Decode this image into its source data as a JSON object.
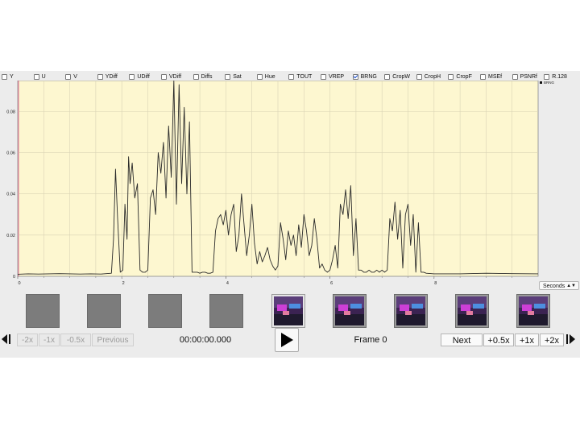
{
  "filters": [
    {
      "label": "Y",
      "checked": false
    },
    {
      "label": "U",
      "checked": false
    },
    {
      "label": "V",
      "checked": false
    },
    {
      "label": "YDiff",
      "checked": false
    },
    {
      "label": "UDiff",
      "checked": false
    },
    {
      "label": "VDiff",
      "checked": false
    },
    {
      "label": "Diffs",
      "checked": false
    },
    {
      "label": "Sat",
      "checked": false
    },
    {
      "label": "Hue",
      "checked": false
    },
    {
      "label": "TOUT",
      "checked": false
    },
    {
      "label": "VREP",
      "checked": false
    },
    {
      "label": "BRNG",
      "checked": true
    },
    {
      "label": "CropW",
      "checked": false
    },
    {
      "label": "CropH",
      "checked": false
    },
    {
      "label": "CropF",
      "checked": false
    },
    {
      "label": "MSEf",
      "checked": false
    },
    {
      "label": "PSNRf",
      "checked": false
    },
    {
      "label": "R.128",
      "checked": false
    }
  ],
  "chart_data": {
    "type": "line",
    "legend": [
      "BRNG"
    ],
    "legend_placement": "top-right",
    "xlim": [
      0,
      10.0
    ],
    "ylim": [
      0,
      0.095
    ],
    "xticks": [
      "0",
      "2",
      "4",
      "6",
      "8"
    ],
    "yticks": [
      "0",
      "0.02",
      "0.04",
      "0.06",
      "0.08"
    ],
    "grid": true,
    "background": "#fdf7d0",
    "line_color": "#2a2a2a",
    "series": [
      {
        "x": [
          0,
          0.2,
          0.4,
          0.6,
          0.8,
          1.0,
          1.2,
          1.4,
          1.6,
          1.8,
          1.84,
          1.88,
          1.92,
          1.97,
          2.02,
          2.06,
          2.1,
          2.13,
          2.16,
          2.2,
          2.25,
          2.3,
          2.35,
          2.4,
          2.45,
          2.5,
          2.55,
          2.6,
          2.65,
          2.7,
          2.75,
          2.8,
          2.85,
          2.9,
          2.95,
          3.0,
          3.05,
          3.1,
          3.15,
          3.2,
          3.25,
          3.3,
          3.35,
          3.4,
          3.45,
          3.5,
          3.55,
          3.6,
          3.65,
          3.7,
          3.75,
          3.8,
          3.85,
          3.9,
          3.95,
          4.0,
          4.05,
          4.1,
          4.15,
          4.2,
          4.25,
          4.3,
          4.35,
          4.4,
          4.45,
          4.5,
          4.55,
          4.6,
          4.65,
          4.7,
          4.75,
          4.8,
          4.85,
          4.9,
          4.95,
          5.0,
          5.05,
          5.1,
          5.15,
          5.2,
          5.25,
          5.3,
          5.35,
          5.4,
          5.45,
          5.5,
          5.55,
          5.6,
          5.65,
          5.7,
          5.75,
          5.8,
          5.85,
          5.9,
          5.95,
          6.0,
          6.05,
          6.1,
          6.15,
          6.2,
          6.25,
          6.3,
          6.35,
          6.4,
          6.45,
          6.5,
          6.55,
          6.6,
          6.65,
          6.7,
          6.75,
          6.8,
          6.85,
          6.9,
          6.95,
          7.0,
          7.05,
          7.1,
          7.15,
          7.2,
          7.25,
          7.3,
          7.35,
          7.4,
          7.45,
          7.5,
          7.55,
          7.6,
          7.65,
          7.7,
          7.75,
          7.8,
          7.85,
          8.0,
          8.5,
          9.0,
          9.5,
          10.0
        ],
        "y": [
          0.001,
          0.0012,
          0.0011,
          0.0012,
          0.0013,
          0.0012,
          0.0011,
          0.0012,
          0.0011,
          0.0015,
          0.018,
          0.052,
          0.028,
          0.002,
          0.003,
          0.035,
          0.018,
          0.058,
          0.045,
          0.055,
          0.038,
          0.045,
          0.003,
          0.002,
          0.002,
          0.003,
          0.038,
          0.042,
          0.03,
          0.06,
          0.05,
          0.065,
          0.038,
          0.073,
          0.048,
          0.095,
          0.035,
          0.093,
          0.045,
          0.082,
          0.04,
          0.075,
          0.002,
          0.002,
          0.002,
          0.0015,
          0.002,
          0.002,
          0.0015,
          0.0015,
          0.002,
          0.022,
          0.028,
          0.03,
          0.025,
          0.032,
          0.02,
          0.03,
          0.035,
          0.012,
          0.02,
          0.04,
          0.025,
          0.01,
          0.02,
          0.035,
          0.016,
          0.006,
          0.012,
          0.007,
          0.01,
          0.014,
          0.008,
          0.005,
          0.003,
          0.005,
          0.026,
          0.018,
          0.008,
          0.022,
          0.015,
          0.02,
          0.01,
          0.025,
          0.014,
          0.03,
          0.022,
          0.01,
          0.015,
          0.028,
          0.018,
          0.004,
          0.006,
          0.003,
          0.002,
          0.003,
          0.008,
          0.015,
          0.004,
          0.035,
          0.03,
          0.042,
          0.028,
          0.044,
          0.01,
          0.028,
          0.003,
          0.003,
          0.002,
          0.002,
          0.003,
          0.002,
          0.002,
          0.003,
          0.002,
          0.003,
          0.002,
          0.003,
          0.028,
          0.022,
          0.036,
          0.018,
          0.032,
          0.004,
          0.03,
          0.035,
          0.015,
          0.03,
          0.002,
          0.026,
          0.002,
          0.002,
          0.0015,
          0.0012,
          0.0012,
          0.0015,
          0.0013,
          0.0012
        ]
      }
    ]
  },
  "thumbnails": [
    {
      "kind": "blank"
    },
    {
      "kind": "blank"
    },
    {
      "kind": "blank"
    },
    {
      "kind": "blank"
    },
    {
      "kind": "image",
      "selected": true
    },
    {
      "kind": "image",
      "selected": false
    },
    {
      "kind": "image",
      "selected": false
    },
    {
      "kind": "image",
      "selected": false
    },
    {
      "kind": "image",
      "selected": false
    }
  ],
  "unit_select": {
    "value": "Seconds"
  },
  "controls": {
    "minus_2x": "-2x",
    "minus_1x": "-1x",
    "minus_half": "-0.5x",
    "previous": "Previous",
    "timecode": "00:00:00.000",
    "frame_label": "Frame 0",
    "next": "Next",
    "plus_half": "+0.5x",
    "plus_1x": "+1x",
    "plus_2x": "+2x"
  }
}
